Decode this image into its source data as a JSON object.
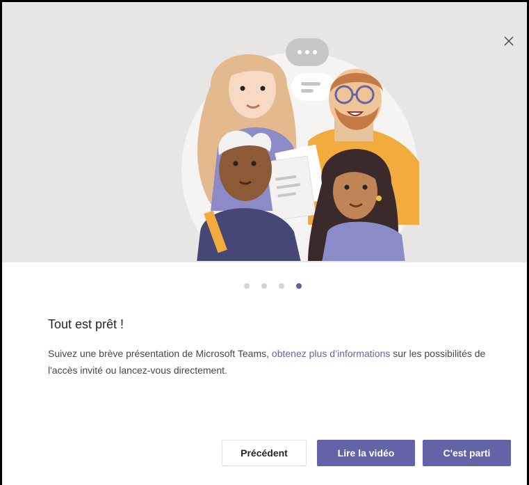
{
  "dialog": {
    "close_icon": "close-icon",
    "hero_illustration": "people-collaborating-illustration",
    "carousel": {
      "total_steps": 4,
      "current_step": 4
    },
    "title": "Tout est prêt !",
    "description": {
      "before_link": "Suivez une brève présentation de Microsoft Teams, ",
      "link_text": "obtenez plus d’informations",
      "after_link": " sur les possibilités de l'accès invité ou lancez-vous directement."
    },
    "buttons": {
      "previous": "Précédent",
      "play_video": "Lire la vidéo",
      "start": "C'est parti"
    },
    "colors": {
      "accent": "#6264a7",
      "hero_background": "#e8e6e5",
      "active_dot": "#5b5fa3",
      "inactive_dot": "#d6d4d3"
    }
  }
}
